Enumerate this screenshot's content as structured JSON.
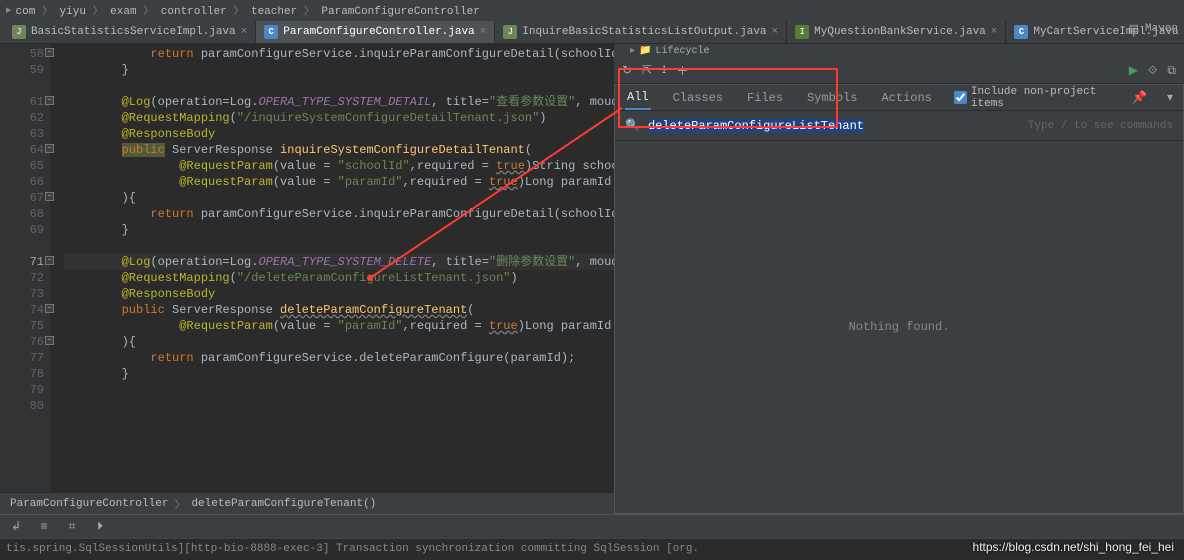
{
  "breadcrumb_top": {
    "items": [
      "com",
      "yiyu",
      "exam",
      "controller",
      "teacher",
      "ParamConfigureController"
    ]
  },
  "tabs_items": [
    {
      "icon": "J",
      "cls": "fi-j",
      "label": "BasicStatisticsServiceImpl.java",
      "active": false
    },
    {
      "icon": "C",
      "cls": "fi-c",
      "label": "ParamConfigureController.java",
      "active": true
    },
    {
      "icon": "J",
      "cls": "fi-j",
      "label": "InquireBasicStatisticsListOutput.java",
      "active": false
    },
    {
      "icon": "I",
      "cls": "fi-i",
      "label": "MyQuestionBankService.java",
      "active": false
    },
    {
      "icon": "C",
      "cls": "fi-c",
      "label": "MyCartServiceImpl.java",
      "active": false
    }
  ],
  "tabs_right_icon": "▤",
  "maven_label": "Maven",
  "lifecycle_label": "Lifecycle",
  "toolbar_icons": {
    "reload": "↻",
    "collapse": "⇱",
    "download": "⭳",
    "add": "＋",
    "sep": "",
    "run": "▶",
    "debug": "⟐",
    "skip": "⧉"
  },
  "gutter_lines": [
    "58",
    "59",
    "",
    "61",
    "62",
    "63",
    "64",
    "65",
    "66",
    "67",
    "68",
    "69",
    "",
    "71",
    "72",
    "73",
    "74",
    "75",
    "76",
    "77",
    "78",
    "79",
    "80"
  ],
  "code_rows": [
    {
      "hl": false,
      "html": "            <span class='kw'>return</span> paramConfigureService.inquireParamConfigureDetail(schoolId, paramId);"
    },
    {
      "hl": false,
      "html": "        }"
    },
    {
      "hl": false,
      "html": ""
    },
    {
      "hl": false,
      "html": "        <span class='ann'>@Log</span>(operation=Log.<span class='const'>OPERA_TYPE_SYSTEM_DETAIL</span>, title=<span class='str'>\"查看参数设置\"</span>, moudle = <span class='str'>\"系统设置\"</span>, sub"
    },
    {
      "hl": false,
      "html": "        <span class='ann'>@RequestMapping</span>(<span class='str'>\"/inquireSystemConfigureDetailTenant.json\"</span>)"
    },
    {
      "hl": false,
      "html": "        <span class='ann'>@ResponseBody</span>"
    },
    {
      "hl": false,
      "html": "        <span class='kw pubhl'>public</span> ServerResponse <span class='mname'>inquireSystemConfigureDetailTenant</span>("
    },
    {
      "hl": false,
      "html": "                <span class='ann'>@RequestParam</span>(value = <span class='str'>\"schoolId\"</span>,required = <span class='kw warn'>true</span>)String schoolId,"
    },
    {
      "hl": false,
      "html": "                <span class='ann'>@RequestParam</span>(value = <span class='str'>\"paramId\"</span>,required = <span class='kw warn'>true</span>)Long paramId"
    },
    {
      "hl": false,
      "html": "        ){"
    },
    {
      "hl": false,
      "html": "            <span class='kw'>return</span> paramConfigureService.inquireParamConfigureDetail(schoolId, paramId);"
    },
    {
      "hl": false,
      "html": "        }"
    },
    {
      "hl": false,
      "html": ""
    },
    {
      "hl": true,
      "html": "        <span class='ann'>@Log</span>(operation=Log.<span class='const'>OPERA_TYPE_SYSTEM_DELETE</span>, title=<span class='str'>\"删除参数设置\"</span>, moudle = <span class='str'>\"系统设置\"</span>, sub"
    },
    {
      "hl": false,
      "html": "        <span class='ann'>@RequestMapping</span>(<span class='str'>\"/deleteParamConfigureListTenant.json\"</span>)"
    },
    {
      "hl": false,
      "html": "        <span class='ann'>@ResponseBody</span>"
    },
    {
      "hl": false,
      "html": "        <span class='kw'>public</span> ServerResponse <span class='mname warn'>deleteParamConfigureTenant</span>("
    },
    {
      "hl": false,
      "html": "                <span class='ann'>@RequestParam</span>(value = <span class='str'>\"paramId\"</span>,required = <span class='kw warn'>true</span>)Long paramId"
    },
    {
      "hl": false,
      "html": "        ){"
    },
    {
      "hl": false,
      "html": "            <span class='kw'>return</span> paramConfigureService.deleteParamConfigure(paramId);"
    },
    {
      "hl": false,
      "html": "        }"
    },
    {
      "hl": false,
      "html": ""
    },
    {
      "hl": false,
      "html": ""
    }
  ],
  "crumb_bottom": {
    "class": "ParamConfigureController",
    "method": "deleteParamConfigureTenant()"
  },
  "tool_icons": {
    "a": "↲",
    "b": "≡",
    "c": "⌗",
    "d": "⏵"
  },
  "console_line": "tis.spring.SqlSessionUtils][http-bio-8888-exec-3] Transaction synchronization committing SqlSession [org.",
  "se": {
    "tabs": {
      "all": "All",
      "classes": "Classes",
      "files": "Files",
      "symbols": "Symbols",
      "actions": "Actions"
    },
    "chk_label": "Include non-project items",
    "chk_checked": true,
    "query": "deleteParamConfigureListTenant",
    "hint": "Type / to see commands",
    "nothing": "Nothing found."
  },
  "watermark": "https://blog.csdn.net/shi_hong_fei_hei"
}
